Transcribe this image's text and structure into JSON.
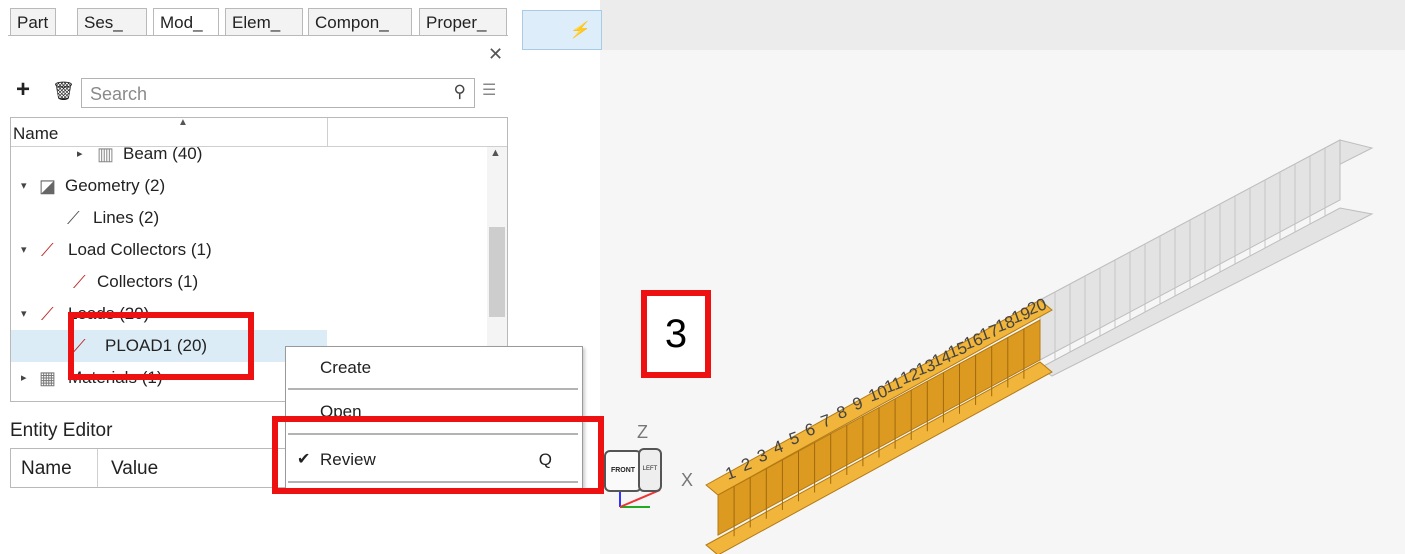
{
  "tabs": [
    {
      "label": "Part",
      "active": false
    },
    {
      "label": "Ses_",
      "active": false
    },
    {
      "label": "Mod_",
      "active": true
    },
    {
      "label": "Elem_",
      "active": false
    },
    {
      "label": "Compon_",
      "active": false
    },
    {
      "label": "Proper_",
      "active": false
    }
  ],
  "toolbar": {
    "run_label": "/"
  },
  "search": {
    "placeholder": "Search"
  },
  "tree": {
    "header_name": "Name",
    "rows": [
      {
        "label": "Beam",
        "count": "(40)",
        "icon": "beam-icon"
      },
      {
        "label": "Geometry",
        "count": "(2)",
        "icon": "geometry-icon"
      },
      {
        "label": "Lines",
        "count": "(2)",
        "icon": "lines-icon"
      },
      {
        "label": "Load Collectors",
        "count": "(1)",
        "icon": "load-collector-icon"
      },
      {
        "label": "Collectors",
        "count": "(1)",
        "icon": "load-collector-icon"
      },
      {
        "label": "Loads",
        "count": "(20)",
        "icon": "load-icon"
      },
      {
        "label": "PLOAD1",
        "count": "(20)",
        "icon": "load-icon",
        "selected": true
      },
      {
        "label": "Materials",
        "count": "(1)",
        "icon": "material-icon"
      }
    ]
  },
  "entity_editor": {
    "title": "Entity Editor",
    "col_name": "Name",
    "col_value": "Value"
  },
  "context_menu": {
    "items": [
      {
        "label": "Create",
        "checked": false,
        "shortcut": ""
      },
      {
        "label": "Open",
        "checked": false,
        "shortcut": ""
      },
      {
        "label": "Review",
        "checked": true,
        "shortcut": "Q"
      }
    ]
  },
  "step_label": "3",
  "view_cube": {
    "front": "FRONT",
    "left": "LEFT"
  },
  "axes": {
    "z": "Z",
    "x": "X"
  },
  "node_labels": [
    "1",
    "2",
    "3",
    "4",
    "5",
    "6",
    "7",
    "8",
    "9",
    "10",
    "11",
    "12",
    "13",
    "14",
    "15",
    "16",
    "17",
    "18",
    "19",
    "20"
  ],
  "colors": {
    "beam_loaded": "#e6a72a",
    "beam_unloaded": "#d8d8d8",
    "highlight": "#ee1111",
    "selection": "#dcecf7"
  }
}
